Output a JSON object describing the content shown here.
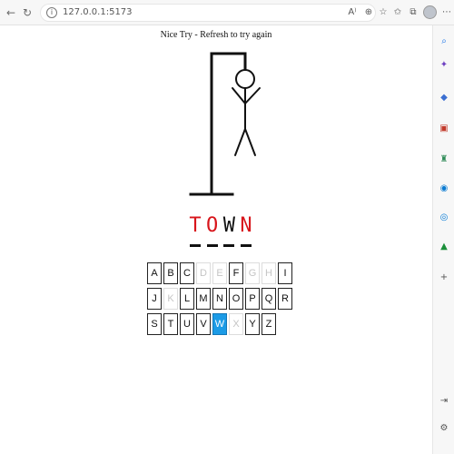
{
  "browser": {
    "url": "127.0.0.1:5173"
  },
  "game": {
    "status_message": "Nice Try - Refresh to try again",
    "word": [
      {
        "letter": "T",
        "color": "#d8151b"
      },
      {
        "letter": "O",
        "color": "#d8151b"
      },
      {
        "letter": "W",
        "color": "#111111"
      },
      {
        "letter": "N",
        "color": "#d8151b"
      }
    ],
    "keyboard_rows": [
      [
        {
          "letter": "A",
          "state": "enabled"
        },
        {
          "letter": "B",
          "state": "enabled"
        },
        {
          "letter": "C",
          "state": "enabled"
        },
        {
          "letter": "D",
          "state": "disabled"
        },
        {
          "letter": "E",
          "state": "disabled"
        },
        {
          "letter": "F",
          "state": "enabled"
        },
        {
          "letter": "G",
          "state": "disabled"
        },
        {
          "letter": "H",
          "state": "disabled"
        },
        {
          "letter": "I",
          "state": "enabled"
        }
      ],
      [
        {
          "letter": "J",
          "state": "enabled"
        },
        {
          "letter": "K",
          "state": "disabled"
        },
        {
          "letter": "L",
          "state": "enabled"
        },
        {
          "letter": "M",
          "state": "enabled"
        },
        {
          "letter": "N",
          "state": "enabled"
        },
        {
          "letter": "O",
          "state": "enabled"
        },
        {
          "letter": "P",
          "state": "enabled"
        },
        {
          "letter": "Q",
          "state": "enabled"
        },
        {
          "letter": "R",
          "state": "enabled"
        }
      ],
      [
        {
          "letter": "S",
          "state": "enabled"
        },
        {
          "letter": "T",
          "state": "enabled"
        },
        {
          "letter": "U",
          "state": "enabled"
        },
        {
          "letter": "V",
          "state": "enabled"
        },
        {
          "letter": "W",
          "state": "active"
        },
        {
          "letter": "X",
          "state": "disabled"
        },
        {
          "letter": "Y",
          "state": "enabled"
        },
        {
          "letter": "Z",
          "state": "enabled"
        }
      ]
    ]
  },
  "colors": {
    "active_key": "#1c9be6",
    "missed_letter": "#d8151b"
  }
}
